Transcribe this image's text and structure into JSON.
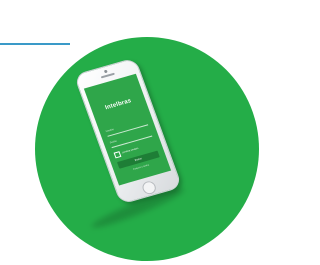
{
  "brand": {
    "name": "Intelbras"
  },
  "login": {
    "user_placeholder": "Usuário",
    "password_placeholder": "Senha",
    "remember_label": "Lembrar usuário",
    "submit_label": "Entrar",
    "footer_link": "Esqueci a senha"
  },
  "icons": {
    "phone": "smartphone-icon"
  },
  "colors": {
    "circle": "#24ad48",
    "screen": "#2fa64a",
    "button": "#1e7e36",
    "accent_line": "#3a9ac8"
  }
}
